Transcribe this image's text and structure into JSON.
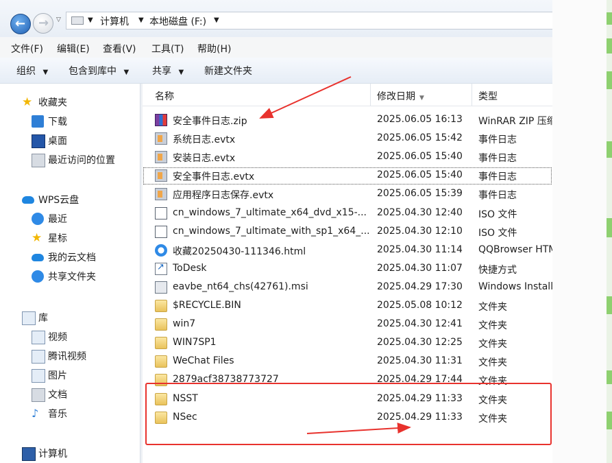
{
  "address": {
    "crumbs": [
      "计算机",
      "本地磁盘 (F:)"
    ]
  },
  "menu": [
    "文件(F)",
    "编辑(E)",
    "查看(V)",
    "工具(T)",
    "帮助(H)"
  ],
  "toolbar": [
    "组织",
    "包含到库中",
    "共享",
    "新建文件夹"
  ],
  "nav": {
    "favorites": {
      "label": "收藏夹",
      "items": [
        "下载",
        "桌面",
        "最近访问的位置"
      ]
    },
    "wps": {
      "label": "WPS云盘",
      "items": [
        "最近",
        "星标",
        "我的云文档",
        "共享文件夹"
      ]
    },
    "library": {
      "label": "库",
      "items": [
        "视频",
        "腾讯视频",
        "图片",
        "文档",
        "音乐"
      ]
    },
    "computer": {
      "label": "计算机"
    }
  },
  "columns": {
    "name": "名称",
    "date": "修改日期",
    "type": "类型"
  },
  "files": [
    {
      "name": "安全事件日志.zip",
      "date": "2025.06.05 16:13",
      "type": "WinRAR ZIP 压缩",
      "icon": "zip-icon"
    },
    {
      "name": "系统日志.evtx",
      "date": "2025.06.05 15:42",
      "type": "事件日志",
      "icon": "event-log-icon"
    },
    {
      "name": "安装日志.evtx",
      "date": "2025.06.05 15:40",
      "type": "事件日志",
      "icon": "event-log-icon"
    },
    {
      "name": "安全事件日志.evtx",
      "date": "2025.06.05 15:40",
      "type": "事件日志",
      "icon": "event-log-icon"
    },
    {
      "name": "应用程序日志保存.evtx",
      "date": "2025.06.05 15:39",
      "type": "事件日志",
      "icon": "event-log-icon"
    },
    {
      "name": "cn_windows_7_ultimate_x64_dvd_x15-...",
      "date": "2025.04.30 12:40",
      "type": "ISO 文件",
      "icon": "disc-image-icon"
    },
    {
      "name": "cn_windows_7_ultimate_with_sp1_x64_...",
      "date": "2025.04.30 12:10",
      "type": "ISO 文件",
      "icon": "disc-image-icon"
    },
    {
      "name": "收藏20250430-111346.html",
      "date": "2025.04.30 11:14",
      "type": "QQBrowser HTML",
      "icon": "browser-html-icon"
    },
    {
      "name": "ToDesk",
      "date": "2025.04.30 11:07",
      "type": "快捷方式",
      "icon": "shortcut-icon"
    },
    {
      "name": "eavbe_nt64_chs(42761).msi",
      "date": "2025.04.29 17:30",
      "type": "Windows Installer",
      "icon": "installer-icon"
    },
    {
      "name": "$RECYCLE.BIN",
      "date": "2025.05.08 10:12",
      "type": "文件夹",
      "icon": "folder-icon"
    },
    {
      "name": "win7",
      "date": "2025.04.30 12:41",
      "type": "文件夹",
      "icon": "folder-icon"
    },
    {
      "name": "WIN7SP1",
      "date": "2025.04.30 12:25",
      "type": "文件夹",
      "icon": "folder-icon"
    },
    {
      "name": "WeChat Files",
      "date": "2025.04.30 11:31",
      "type": "文件夹",
      "icon": "folder-icon"
    },
    {
      "name": "2879acf38738773727",
      "date": "2025.04.29 17:44",
      "type": "文件夹",
      "icon": "folder-icon"
    },
    {
      "name": "NSST",
      "date": "2025.04.29 11:33",
      "type": "文件夹",
      "icon": "folder-icon"
    },
    {
      "name": "NSec",
      "date": "2025.04.29 11:33",
      "type": "文件夹",
      "icon": "folder-icon"
    }
  ],
  "colors": {
    "annotation_red": "#e8322d",
    "accent_green": "#8ed070"
  }
}
